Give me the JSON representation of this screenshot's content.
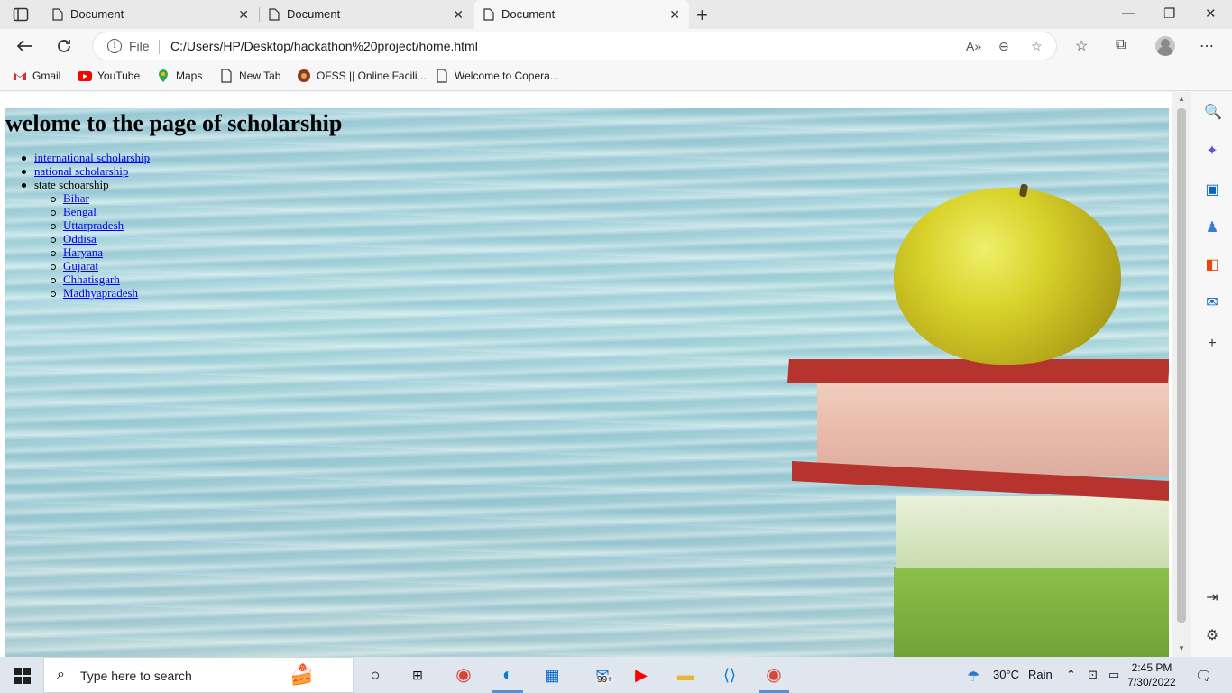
{
  "browser": {
    "tabs": [
      {
        "label": "Document"
      },
      {
        "label": "Document"
      },
      {
        "label": "Document"
      }
    ],
    "address": {
      "scheme_label": "File",
      "url": "C:/Users/HP/Desktop/hackathon%20project/home.html"
    },
    "bookmarks": [
      {
        "label": "Gmail"
      },
      {
        "label": "YouTube"
      },
      {
        "label": "Maps"
      },
      {
        "label": "New Tab"
      },
      {
        "label": "OFSS || Online Facili..."
      },
      {
        "label": "Welcome to Copera..."
      }
    ]
  },
  "page": {
    "heading": "welome to the page of scholarship",
    "items": [
      {
        "label": "international scholarship"
      },
      {
        "label": "national scholarship"
      },
      {
        "label": "state schoarship"
      }
    ],
    "states": [
      "Bihar",
      "Bengal",
      "Uttarpradesh",
      "Oddisa",
      "Haryana",
      "Gujarat",
      "Chhatisgarh",
      "Madhyapradesh"
    ]
  },
  "taskbar": {
    "search_placeholder": "Type here to search",
    "mail_badge": "99+",
    "weather_temp": "30°C",
    "weather_text": "Rain",
    "time": "2:45 PM",
    "date": "7/30/2022"
  },
  "colors": {
    "link": "#0000ee",
    "accent": "#0078d4"
  }
}
